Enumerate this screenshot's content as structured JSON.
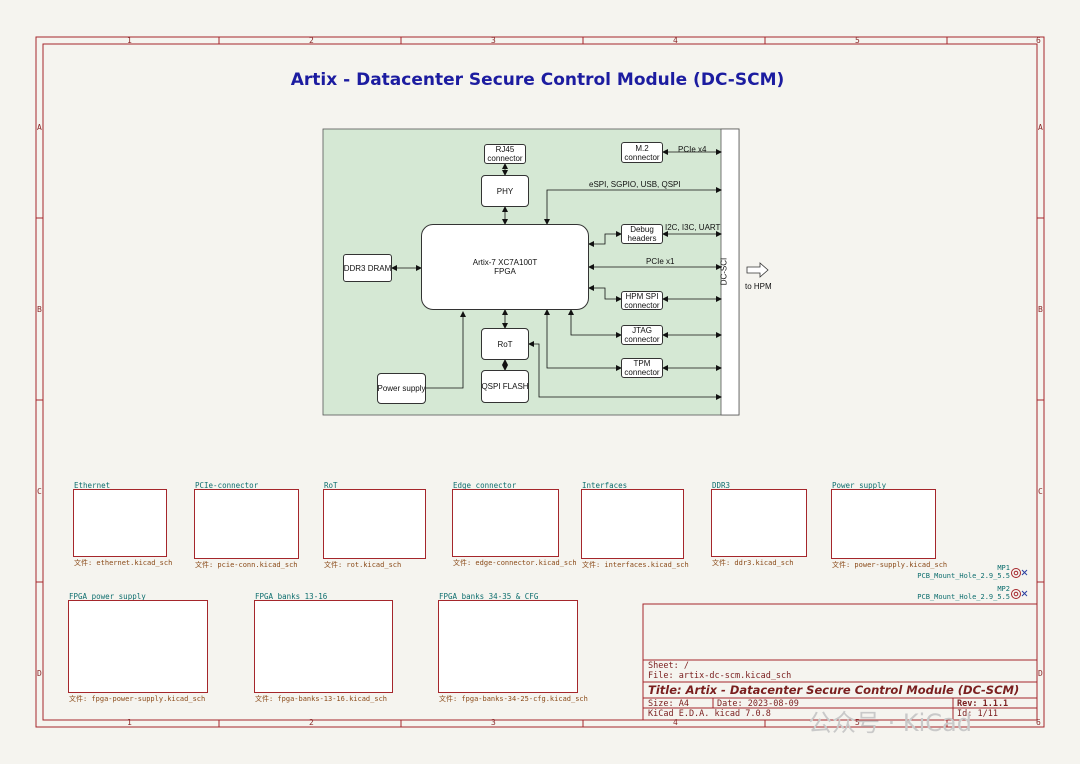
{
  "sheet_title": "Artix - Datacenter Secure Control Module (DC-SCM)",
  "zones": {
    "columns": [
      "1",
      "2",
      "3",
      "4",
      "5",
      "6"
    ],
    "rows": [
      "A",
      "B",
      "C",
      "D"
    ]
  },
  "block_diagram": {
    "fpga": "Artix-7 XC7A100T\nFPGA",
    "rj45": "RJ45\nconnector",
    "phy": "PHY",
    "ddr3": "DDR3 DRAM",
    "rot": "RoT",
    "qspi": "QSPI FLASH",
    "power": "Power supply",
    "m2": "M.2\nconnector",
    "debug": "Debug\nheaders",
    "hpm_spi": "HPM SPI\nconnector",
    "jtag": "JTAG\nconnector",
    "tpm": "TPM\nconnector",
    "dcsci": "DC-SCI",
    "to_hpm": "to HPM",
    "labels": {
      "pcie_x4": "PCIe x4",
      "espi": "eSPI, SGPIO, USB, QSPI",
      "i2c": "I2C, I3C, UART",
      "pcie_x1": "PCIe x1"
    }
  },
  "hier_sheets": [
    {
      "name": "Ethernet",
      "file": "文件: ethernet.kicad_sch"
    },
    {
      "name": "PCIe-connector",
      "file": "文件: pcie-conn.kicad_sch"
    },
    {
      "name": "RoT",
      "file": "文件: rot.kicad_sch"
    },
    {
      "name": "Edge connector",
      "file": "文件: edge-connector.kicad_sch"
    },
    {
      "name": "Interfaces",
      "file": "文件: interfaces.kicad_sch"
    },
    {
      "name": "DDR3",
      "file": "文件: ddr3.kicad_sch"
    },
    {
      "name": "Power supply",
      "file": "文件: power-supply.kicad_sch"
    },
    {
      "name": "FPGA power supply",
      "file": "文件: fpga-power-supply.kicad_sch"
    },
    {
      "name": "FPGA banks 13-16",
      "file": "文件: fpga-banks-13-16.kicad_sch"
    },
    {
      "name": "FPGA banks 34-35 & CFG",
      "file": "文件: fpga-banks-34-25-cfg.kicad_sch"
    }
  ],
  "mounting_holes": [
    {
      "ref": "MP1",
      "value": "PCB_Mount_Hole_2.9_5.5"
    },
    {
      "ref": "MP2",
      "value": "PCB_Mount_Hole_2.9_5.5"
    }
  ],
  "title_block": {
    "sheet": "Sheet: /",
    "file": "File: artix-dc-scm.kicad_sch",
    "title": "Title: Artix - Datacenter Secure Control Module (DC-SCM)",
    "size": "Size: A4",
    "date": "Date: 2023-08-09",
    "rev": "Rev: 1.1.1",
    "tool": "KiCad E.D.A.  kicad 7.0.8",
    "id": "Id: 1/11"
  },
  "watermark": "公众号 · KiCad",
  "colors": {
    "border": "#a5262b",
    "title": "#1c1ca0",
    "diagram_bg": "#d5e8d4",
    "sheet_name": "#0d6e6e"
  }
}
